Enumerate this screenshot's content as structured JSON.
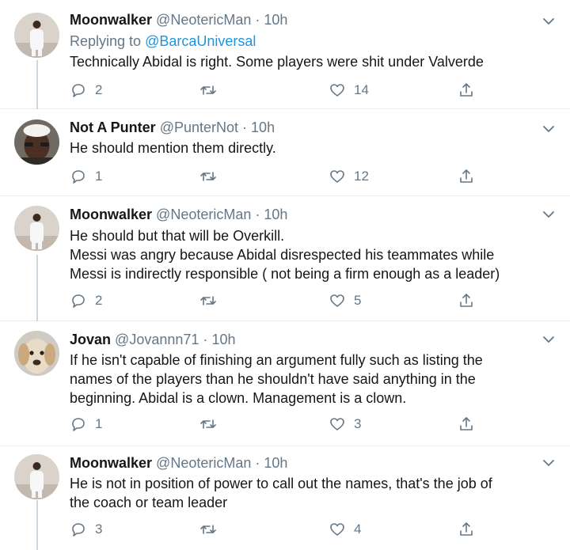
{
  "tweets": [
    {
      "name": "Moonwalker",
      "handle": "@NeotericMan",
      "separator": "·",
      "time": "10h",
      "reply_prefix": "Replying to",
      "reply_to": "@BarcaUniversal",
      "lines": [
        "Technically Abidal is right. Some players were shit under Valverde"
      ],
      "replies": "2",
      "retweets": "",
      "likes": "14"
    },
    {
      "name": "Not A Punter",
      "handle": "@PunterNot",
      "separator": "·",
      "time": "10h",
      "lines": [
        "He should mention them directly."
      ],
      "replies": "1",
      "retweets": "",
      "likes": "12"
    },
    {
      "name": "Moonwalker",
      "handle": "@NeotericMan",
      "separator": "·",
      "time": "10h",
      "lines": [
        "He should but that will be Overkill.",
        "Messi was angry because Abidal disrespected his teammates while",
        "Messi is indirectly responsible ( not being a firm enough as a leader)"
      ],
      "replies": "2",
      "retweets": "",
      "likes": "5"
    },
    {
      "name": "Jovan",
      "handle": "@Jovannn71",
      "separator": "·",
      "time": "10h",
      "lines": [
        "If he isn't capable of finishing an argument fully such as listing the",
        "names of the players than he shouldn't have said anything in the",
        "beginning. Abidal is a clown. Management is a clown."
      ],
      "replies": "1",
      "retweets": "",
      "likes": "3"
    },
    {
      "name": "Moonwalker",
      "handle": "@NeotericMan",
      "separator": "·",
      "time": "10h",
      "lines": [
        "He is not in position of power to call out the names, that's the job of",
        "the coach or team leader"
      ],
      "replies": "3",
      "retweets": "",
      "likes": "4"
    }
  ],
  "icons": {
    "reply": "reply-icon",
    "retweet": "retweet-icon",
    "like": "heart-icon",
    "share": "share-icon",
    "more": "chevron-down-icon"
  },
  "colors": {
    "text": "#14171a",
    "secondary": "#657786",
    "link": "#1b95e0",
    "divider": "#e6ecf0",
    "thread_line": "#ccd6dd"
  }
}
